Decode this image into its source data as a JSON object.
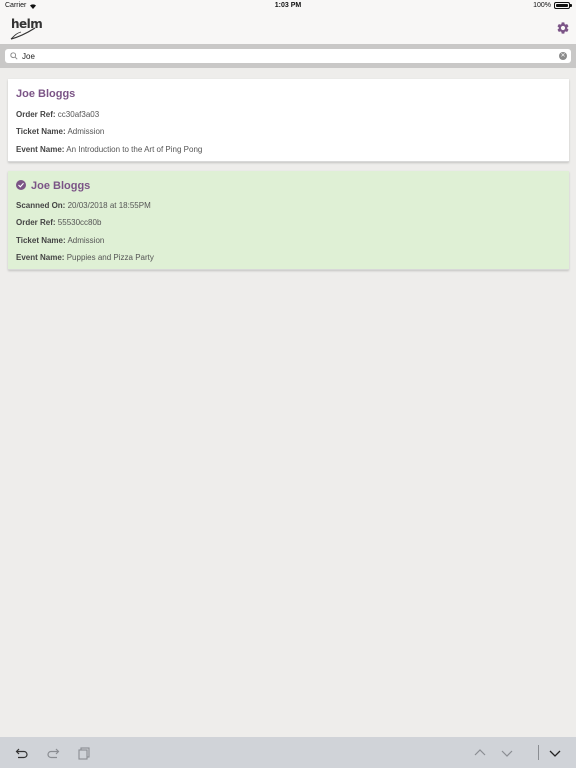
{
  "status_bar": {
    "carrier": "Carrier",
    "time": "1:03 PM",
    "battery": "100%"
  },
  "nav": {
    "logo_text": "helm",
    "accent_color": "#7b5486"
  },
  "search": {
    "value": "Joe",
    "placeholder": "Search"
  },
  "results": [
    {
      "name": "Joe Bloggs",
      "scanned": false,
      "order_ref_label": "Order Ref:",
      "order_ref": "cc30af3a03",
      "ticket_name_label": "Ticket Name:",
      "ticket_name": "Admission",
      "event_name_label": "Event Name:",
      "event_name": "An Introduction to the Art of Ping Pong"
    },
    {
      "name": "Joe Bloggs",
      "scanned": true,
      "scanned_on_label": "Scanned On:",
      "scanned_on": "20/03/2018 at 18:55PM",
      "order_ref_label": "Order Ref:",
      "order_ref": "55530cc80b",
      "ticket_name_label": "Ticket Name:",
      "ticket_name": "Admission",
      "event_name_label": "Event Name:",
      "event_name": "Puppies and Pizza Party"
    }
  ],
  "toolbar": {
    "icons": [
      "undo-icon",
      "redo-icon",
      "paste-icon",
      "chevron-up-icon",
      "chevron-down-icon",
      "dismiss-keyboard-icon"
    ]
  }
}
